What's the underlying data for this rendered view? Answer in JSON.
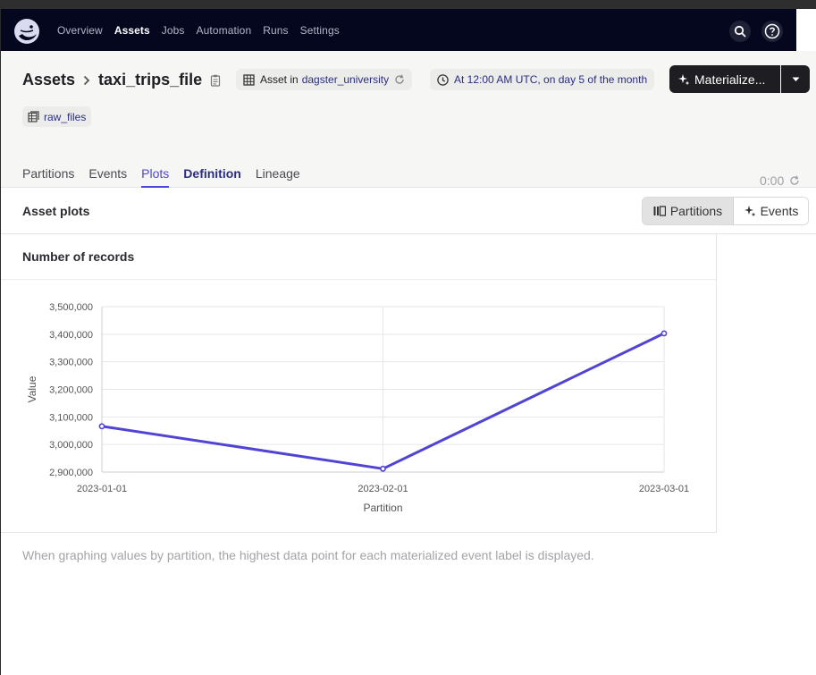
{
  "nav": {
    "links": [
      "Overview",
      "Assets",
      "Jobs",
      "Automation",
      "Runs",
      "Settings"
    ],
    "active": "Assets"
  },
  "header": {
    "breadcrumb_root": "Assets",
    "asset_name": "taxi_trips_file",
    "asset_in_label": "Asset in",
    "code_location": "dagster_university",
    "schedule": "At 12:00 AM UTC, on day 5 of the month",
    "materialize_label": "Materialize...",
    "tag": "raw_files"
  },
  "tabs": [
    {
      "label": "Partitions"
    },
    {
      "label": "Events"
    },
    {
      "label": "Plots"
    },
    {
      "label": "Definition"
    },
    {
      "label": "Lineage"
    }
  ],
  "active_tab": "Plots",
  "timer": "0:00",
  "plots": {
    "title": "Asset plots",
    "mode_partitions": "Partitions",
    "mode_events": "Events",
    "card_title": "Number of records",
    "note": "When graphing values by partition, the highest data point for each materialized event label is displayed."
  },
  "colors": {
    "accent": "#4f44d8",
    "nav_bg": "#05071f",
    "line": "#5144d4"
  },
  "chart_data": {
    "type": "line",
    "xlabel": "Partition",
    "ylabel": "Value",
    "categories": [
      "2023-01-01",
      "2023-02-01",
      "2023-03-01"
    ],
    "values": [
      3066000,
      2912000,
      3403000
    ],
    "ylim": [
      2900000,
      3500000
    ],
    "yticks": [
      "3,500,000",
      "3,400,000",
      "3,300,000",
      "3,200,000",
      "3,100,000",
      "3,000,000",
      "2,900,000"
    ],
    "grid": true
  }
}
